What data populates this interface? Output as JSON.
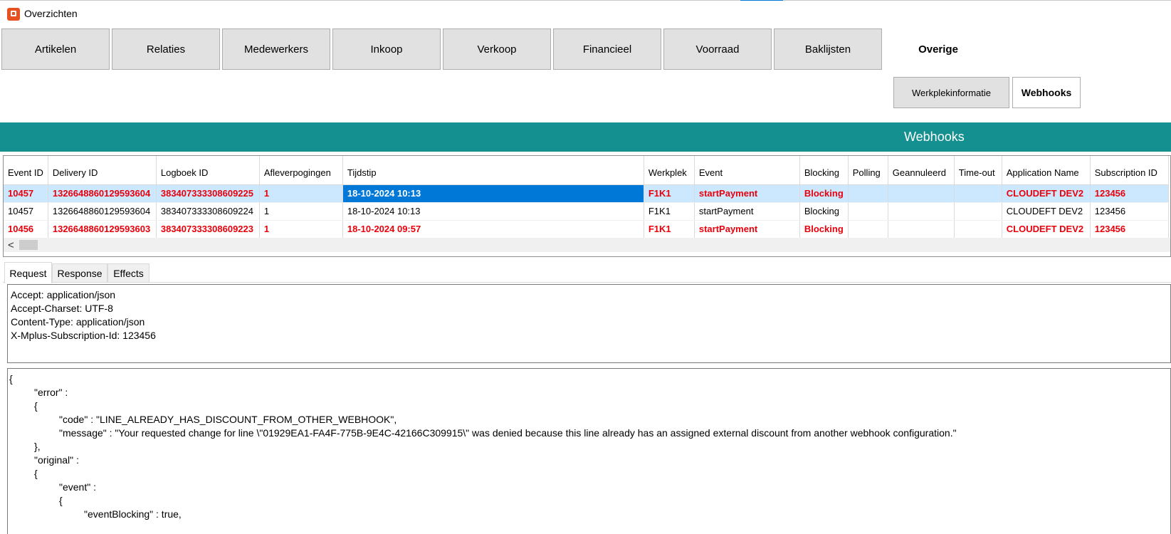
{
  "window": {
    "title": "Overzichten"
  },
  "nav": {
    "tabs": [
      "Artikelen",
      "Relaties",
      "Medewerkers",
      "Inkoop",
      "Verkoop",
      "Financieel",
      "Voorraad",
      "Baklijsten",
      "Overige"
    ],
    "active": "Overige",
    "subtabs": [
      "Werkplekinformatie",
      "Webhooks"
    ],
    "active_subtab": "Webhooks"
  },
  "section": {
    "title": "Webhooks"
  },
  "grid": {
    "columns": [
      "Event ID",
      "Delivery ID",
      "Logboek ID",
      "Afleverpogingen",
      "Tijdstip",
      "Werkplek",
      "Event",
      "Blocking",
      "Polling",
      "Geannuleerd",
      "Time-out",
      "Application Name",
      "Subscription ID"
    ],
    "rows": [
      [
        "10457",
        "1326648860129593604",
        "383407333308609225",
        "1",
        "18-10-2024 10:13",
        "F1K1",
        "startPayment",
        "Blocking",
        "",
        "",
        "",
        "CLOUDEFT DEV2",
        "123456"
      ],
      [
        "10457",
        "1326648860129593604",
        "383407333308609224",
        "1",
        "18-10-2024 10:13",
        "F1K1",
        "startPayment",
        "Blocking",
        "",
        "",
        "",
        "CLOUDEFT DEV2",
        "123456"
      ],
      [
        "10456",
        "1326648860129593603",
        "383407333308609223",
        "1",
        "18-10-2024 09:57",
        "F1K1",
        "startPayment",
        "Blocking",
        "",
        "",
        "",
        "CLOUDEFT DEV2",
        "123456"
      ]
    ],
    "scroll_left_glyph": "<"
  },
  "detail_tabs": [
    "Request",
    "Response",
    "Effects"
  ],
  "active_detail_tab": "Request",
  "request_headers": [
    "Accept: application/json",
    "Accept-Charset: UTF-8",
    "Content-Type: application/json",
    "X-Mplus-Subscription-Id: 123456"
  ],
  "request_body": [
    "{",
    "\t\"error\" :",
    "\t{",
    "\t\t\"code\" : \"LINE_ALREADY_HAS_DISCOUNT_FROM_OTHER_WEBHOOK\",",
    "\t\t\"message\" : \"Your requested change for line \\\"01929EA1-FA4F-775B-9E4C-42166C309915\\\" was denied because this line already has an assigned external discount from another webhook configuration.\"",
    "\t},",
    "\t\"original\" :",
    "\t{",
    "\t\t\"event\" :",
    "\t\t{",
    "\t\t\t\"eventBlocking\" : true,"
  ],
  "colors": {
    "header": "#13908f",
    "error_text": "#e8000b",
    "selection": "#cce8ff",
    "focus": "#0078d7"
  }
}
